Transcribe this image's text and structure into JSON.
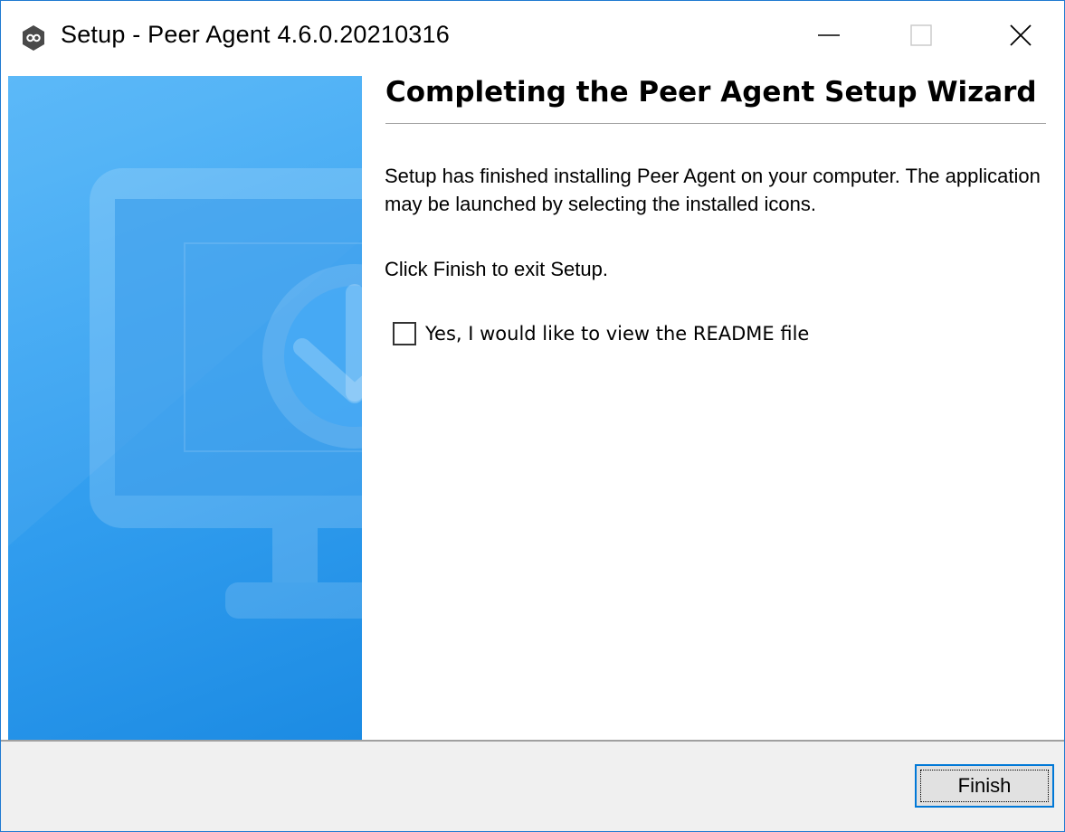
{
  "window": {
    "title": "Setup - Peer Agent 4.6.0.20210316",
    "controls": {
      "minimize": "minimize",
      "maximize": "maximize",
      "close": "close"
    }
  },
  "content": {
    "heading": "Completing the Peer Agent Setup Wizard",
    "paragraph1": "Setup has finished installing Peer Agent on your computer. The application may be launched by selecting the installed icons.",
    "paragraph2": "Click Finish to exit Setup.",
    "readme_checkbox": {
      "label": "Yes, I would like to view the README file",
      "checked": false
    }
  },
  "footer": {
    "finish_label": "Finish"
  },
  "icons": {
    "app": "peer-agent-logo-icon",
    "banner": "monitor-download-icon"
  },
  "colors": {
    "banner_top": "#54b6f8",
    "banner_bottom": "#1c8be3",
    "footer_bg": "#f0f0f0",
    "focus_border": "#0078d7"
  }
}
